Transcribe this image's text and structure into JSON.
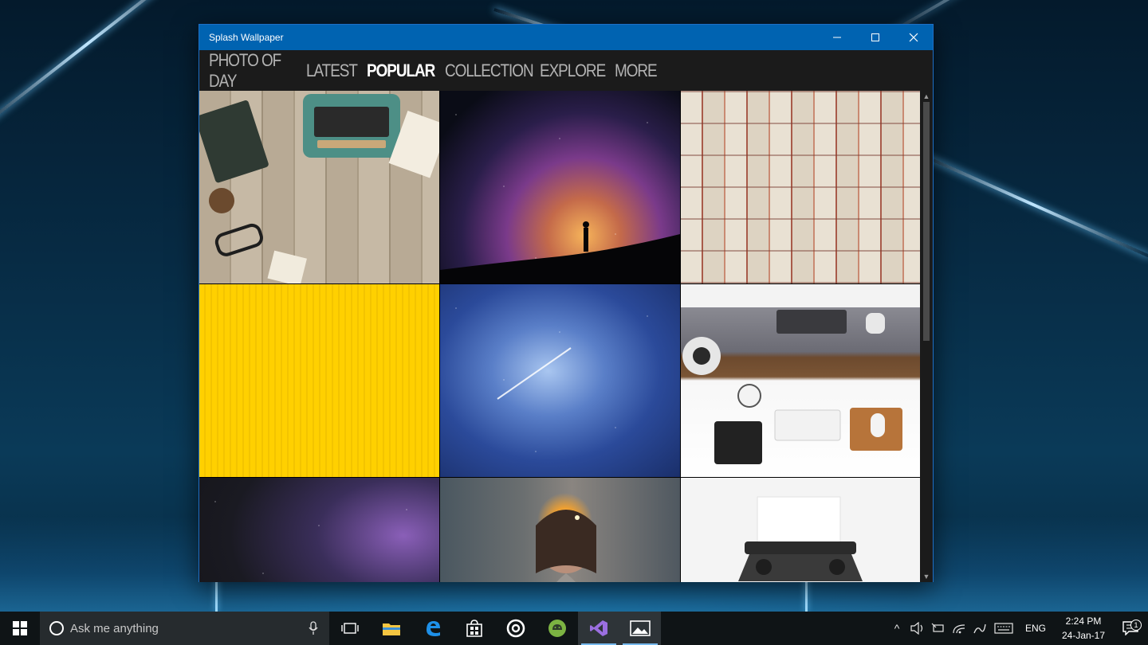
{
  "window": {
    "title": "Splash Wallpaper",
    "titlebar_color": "#0063b1"
  },
  "nav": {
    "tabs": [
      {
        "label": "PHOTO OF DAY",
        "active": false
      },
      {
        "label": "LATEST",
        "active": false
      },
      {
        "label": "POPULAR",
        "active": true
      },
      {
        "label": "COLLECTION",
        "active": false
      },
      {
        "label": "EXPLORE",
        "active": false
      },
      {
        "label": "MORE",
        "active": false
      }
    ]
  },
  "gallery": {
    "tiles": [
      {
        "subject": "typewriter-on-wooden-desk"
      },
      {
        "subject": "milky-way-silhouette"
      },
      {
        "subject": "open-books-wall"
      },
      {
        "subject": "yellow-texture"
      },
      {
        "subject": "starry-sky-meteor"
      },
      {
        "subject": "workspace-top-view"
      },
      {
        "subject": "night-sky-stars"
      },
      {
        "subject": "woman-with-sparkler"
      },
      {
        "subject": "vintage-typewriter"
      }
    ]
  },
  "taskbar": {
    "search_placeholder": "Ask me anything",
    "pinned_icons": [
      "task-view-icon",
      "file-explorer-icon",
      "edge-icon",
      "store-icon",
      "groove-icon",
      "android-icon",
      "visual-studio-icon",
      "splash-wallpaper-icon"
    ],
    "language": "ENG",
    "time": "2:24 PM",
    "date": "24-Jan-17",
    "notification_count": "1"
  }
}
